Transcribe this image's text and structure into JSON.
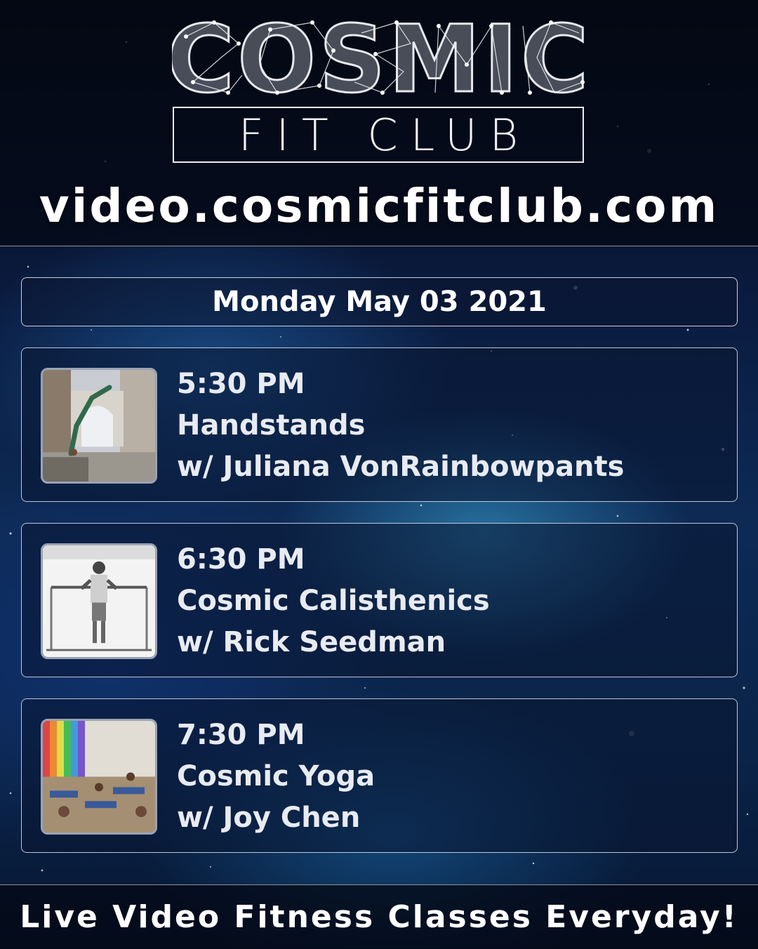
{
  "header": {
    "logo_word": "COSMIC",
    "logo_sub": "FIT CLUB",
    "url": "video.cosmicfitclub.com"
  },
  "date": "Monday May 03 2021",
  "classes": [
    {
      "time": "5:30 PM",
      "name": "Handstands",
      "instructor": "w/ Juliana VonRainbowpants",
      "thumb": "handstand-photo"
    },
    {
      "time": "6:30 PM",
      "name": "Cosmic Calisthenics",
      "instructor": "w/ Rick Seedman",
      "thumb": "calisthenics-photo"
    },
    {
      "time": "7:30 PM",
      "name": "Cosmic Yoga",
      "instructor": "w/ Joy Chen",
      "thumb": "yoga-photo"
    }
  ],
  "footer": {
    "tagline": "Live Video Fitness Classes Everyday!"
  },
  "colors": {
    "background": "#0a1a3d",
    "text": "#ffffff",
    "card_text": "#e8ebf1",
    "border": "#ebf0fa"
  }
}
